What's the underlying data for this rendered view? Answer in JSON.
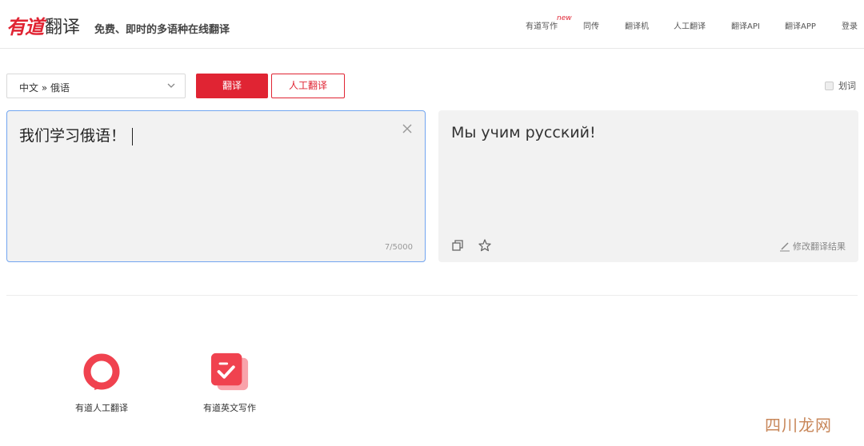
{
  "header": {
    "logo_brand": "有道",
    "logo_product": "翻译",
    "slogan": "免费、即时的多语种在线翻译",
    "nav": {
      "write": "有道写作",
      "write_badge": "new",
      "interpret": "同传",
      "machine": "翻译机",
      "human": "人工翻译",
      "api": "翻译API",
      "app": "翻译APP",
      "login": "登录"
    }
  },
  "toolbar": {
    "language_pair": "中文 » 俄语",
    "translate_label": "翻译",
    "human_translate_label": "人工翻译",
    "huaci_label": "划词",
    "huaci_checked": false
  },
  "source": {
    "text": "我们学习俄语！",
    "char_count": "7/5000"
  },
  "target": {
    "text": "Мы учим русский!",
    "edit_label": "修改翻译结果"
  },
  "products": [
    {
      "label": "有道人工翻译"
    },
    {
      "label": "有道英文写作"
    }
  ],
  "watermark": "四川龙网",
  "colors": {
    "brand_red": "#e02433",
    "focus_blue": "#72a5f0",
    "panel_bg": "#f2f2f2"
  }
}
